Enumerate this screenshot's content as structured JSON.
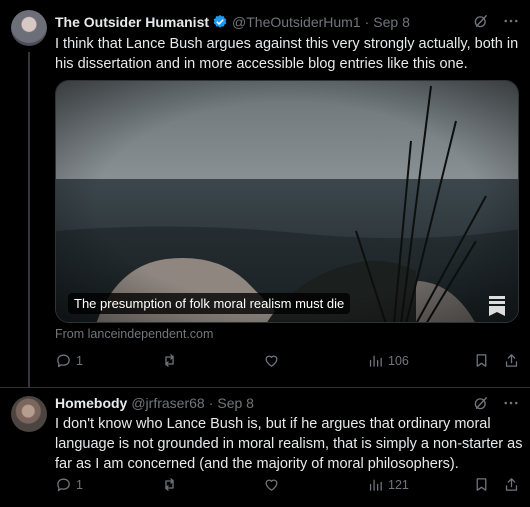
{
  "tweets": [
    {
      "author_name": "The Outsider Humanist",
      "handle": "@TheOutsiderHum1",
      "separator": "·",
      "date": "Sep 8",
      "text": "I think that Lance Bush argues against this very strongly actually, both in his dissertation and in more accessible blog entries like this one.",
      "card": {
        "title": "The presumption of folk moral realism must die",
        "source": "From lanceindependent.com"
      },
      "actions": {
        "replies": "1",
        "reposts": "",
        "likes": "",
        "views": "106"
      }
    },
    {
      "author_name": "Homebody",
      "handle": "@jrfraser68",
      "separator": "·",
      "date": "Sep 8",
      "text": "I don't know who Lance Bush is, but if he argues that ordinary moral language is not grounded in moral realism, that is simply a non-starter as far as I am concerned (and the majority of moral philosophers).",
      "actions": {
        "replies": "1",
        "reposts": "",
        "likes": "",
        "views": "121"
      }
    }
  ],
  "colors": {
    "background": "#000000",
    "text": "#e7e9ea",
    "muted": "#71767b",
    "verified": "#1d9bf0",
    "divider": "#2f3336"
  },
  "icons": [
    "verified-badge-icon",
    "grok-icon",
    "more-icon",
    "reply-icon",
    "repost-icon",
    "like-icon",
    "views-icon",
    "bookmark-icon",
    "share-icon"
  ]
}
